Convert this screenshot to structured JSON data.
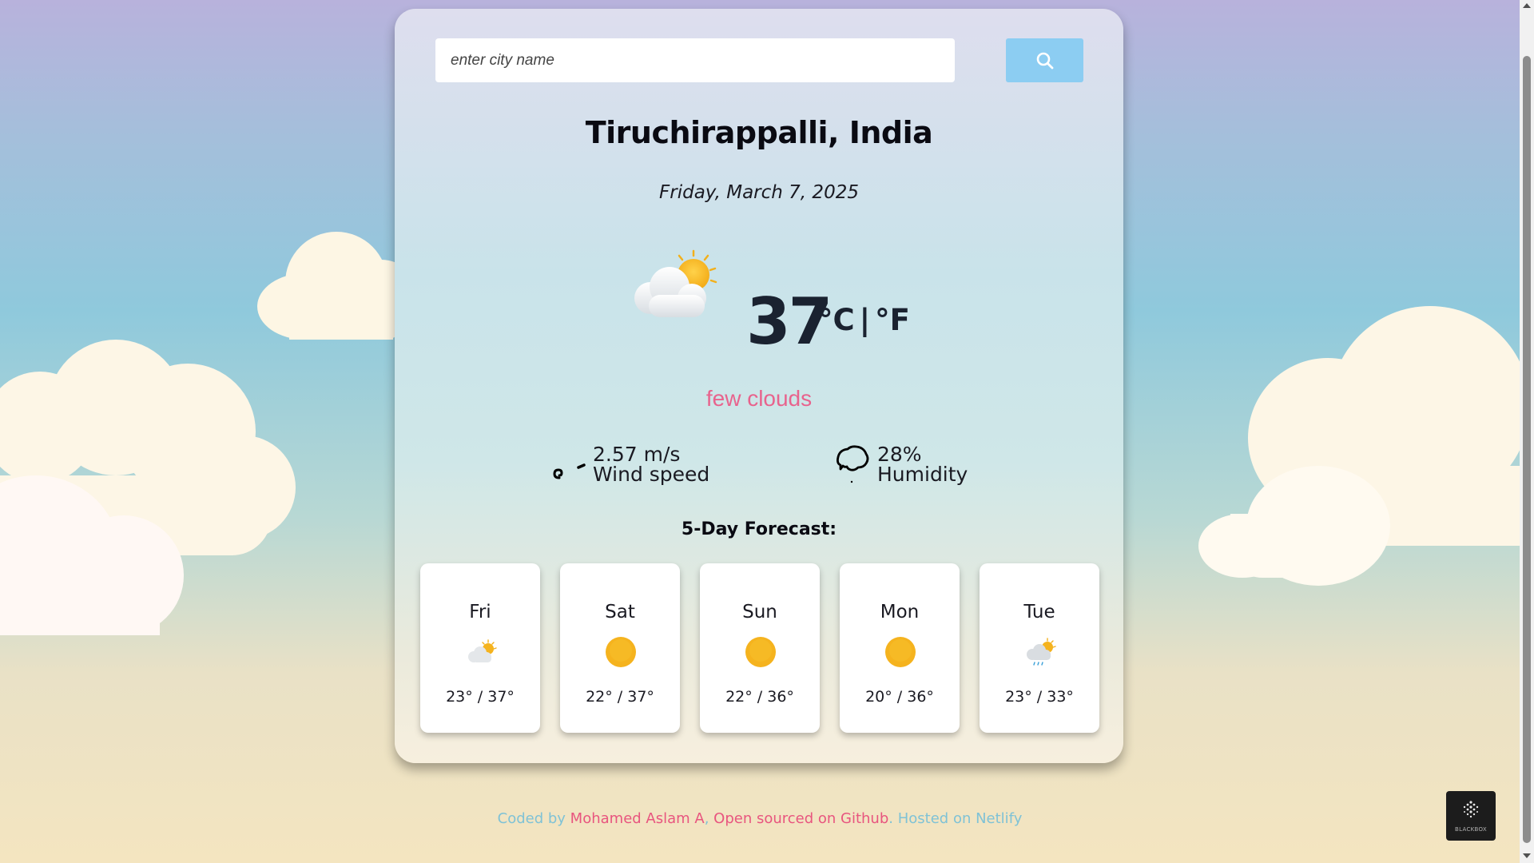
{
  "search": {
    "placeholder": "enter city name",
    "icon": "search-icon"
  },
  "location": {
    "city": "Tiruchirappalli, India",
    "date": "Friday, March 7, 2025"
  },
  "current": {
    "icon": "few-clouds-icon",
    "temperature": "37",
    "unit_c": "°C",
    "separator": "|",
    "unit_f": "°F",
    "description": "few clouds"
  },
  "stats": {
    "wind": {
      "value": "2.57 m/s",
      "label": "Wind speed",
      "icon": "wind-icon"
    },
    "humidity": {
      "value": "28%",
      "label": "Humidity",
      "icon": "humidity-icon"
    }
  },
  "forecast": {
    "title": "5-Day Forecast:",
    "days": [
      {
        "day": "Fri",
        "temps": "23° / 37°",
        "icon": "few-clouds-icon"
      },
      {
        "day": "Sat",
        "temps": "22° / 37°",
        "icon": "sun-icon"
      },
      {
        "day": "Sun",
        "temps": "22° / 36°",
        "icon": "sun-icon"
      },
      {
        "day": "Mon",
        "temps": "20° / 36°",
        "icon": "sun-icon"
      },
      {
        "day": "Tue",
        "temps": "23° / 33°",
        "icon": "rain-icon"
      }
    ]
  },
  "footer": {
    "prefix": "Coded by ",
    "author": "Mohamed Aslam A",
    "comma": ", ",
    "open_source": "Open sourced on Github",
    "dot": ". ",
    "hosted": "Hosted on Netlify"
  },
  "badge": {
    "text": "BLACKBOX"
  },
  "colors": {
    "accent": "#e8638d",
    "search_button": "#8ccdf2",
    "footer_muted": "#7fc2d6"
  }
}
